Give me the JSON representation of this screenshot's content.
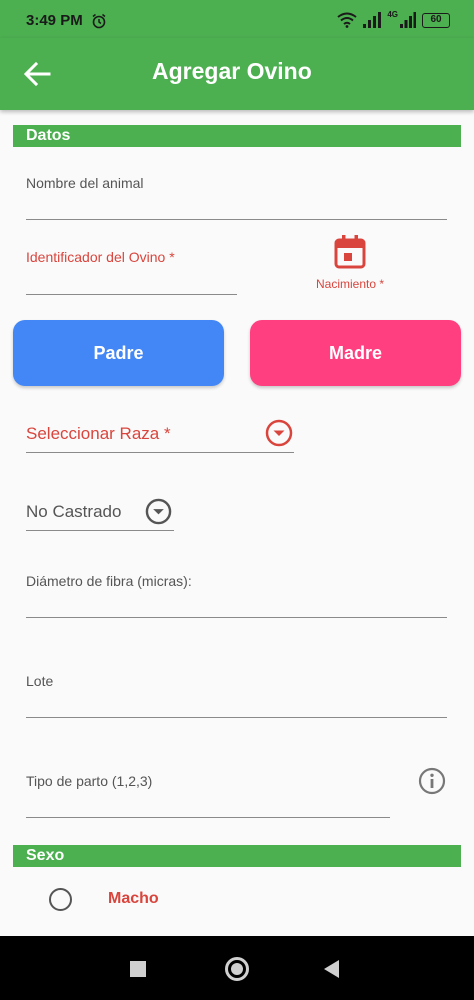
{
  "status": {
    "time": "3:49 PM",
    "battery": "60",
    "network": "4G"
  },
  "appbar": {
    "title": "Agregar Ovino"
  },
  "sections": {
    "datos": "Datos",
    "sexo": "Sexo"
  },
  "form": {
    "nombre_label": "Nombre del animal",
    "identificador_label": "Identificador del Ovino *",
    "nacimiento_label": "Nacimiento *",
    "padre_button": "Padre",
    "madre_button": "Madre",
    "raza_dropdown": "Seleccionar Raza *",
    "castrado_dropdown": "No Castrado",
    "diametro_label": "Diámetro de fibra (micras):",
    "lote_label": "Lote",
    "parto_label": "Tipo de parto (1,2,3)"
  },
  "sexo": {
    "macho_label": "Macho"
  },
  "colors": {
    "primary": "#4caf50",
    "padre": "#4287f5",
    "madre": "#ff3f7f",
    "required": "#d9453d"
  },
  "icons": [
    "back-arrow-icon",
    "calendar-icon",
    "dropdown-icon",
    "info-icon",
    "alarm-icon",
    "wifi-icon",
    "signal-icon",
    "battery-icon"
  ]
}
